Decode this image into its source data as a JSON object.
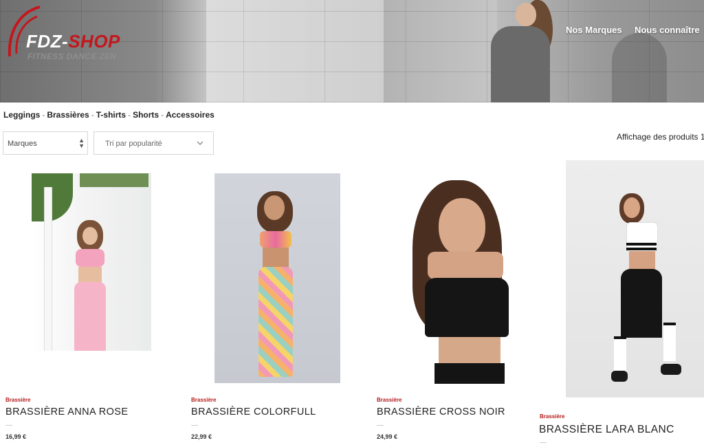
{
  "header": {
    "logo": {
      "main_a": "FDZ",
      "dash": "-",
      "main_b": "SHOP",
      "tagline": "FITNESS DANCE ZEN"
    },
    "nav": [
      {
        "label": "Nos Marques"
      },
      {
        "label": "Nous connaître"
      }
    ]
  },
  "categories": [
    "Leggings",
    "Brassières",
    "T-shirts",
    "Shorts",
    "Accessoires"
  ],
  "category_separator": "-",
  "filters": {
    "brand_select": {
      "value": "Marques"
    },
    "sort_select": {
      "value": "Tri par popularité"
    }
  },
  "results_text": "Affichage des produits 1-",
  "products": [
    {
      "category": "Brassière",
      "name": "BRASSIÈRE ANNA ROSE",
      "price": "16,99 €"
    },
    {
      "category": "Brassière",
      "name": "BRASSIÈRE COLORFULL",
      "price": "22,99 €"
    },
    {
      "category": "Brassière",
      "name": "BRASSIÈRE CROSS NOIR",
      "price": "24,99 €"
    },
    {
      "category": "Brassière",
      "name": "BRASSIÈRE LARA BLANC",
      "price": ""
    }
  ],
  "colors": {
    "accent": "#c4161c",
    "category_red": "#b51b1b"
  }
}
